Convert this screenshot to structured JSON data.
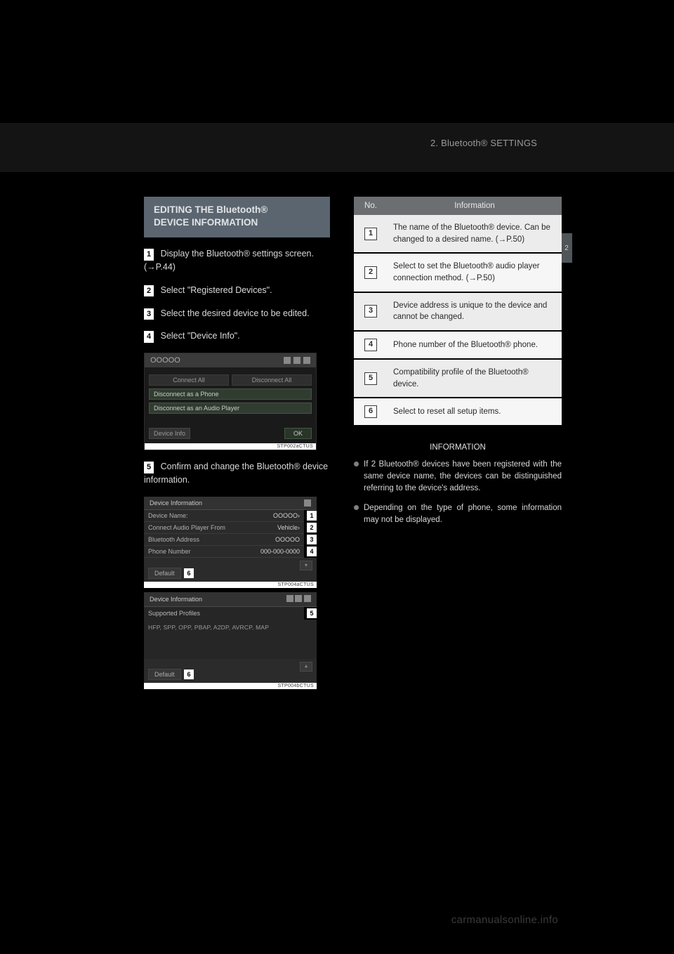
{
  "header": {
    "breadcrumb": "2. Bluetooth® SETTINGS"
  },
  "side_tab": "2",
  "section_title": {
    "line1": "EDITING THE Bluetooth®",
    "line2": "DEVICE INFORMATION"
  },
  "steps": {
    "s1": {
      "num": "1",
      "text": "Display the Bluetooth® settings screen. (→P.44)"
    },
    "s2": {
      "num": "2",
      "prefix": "Select ",
      "quote": "\"Registered Devices\"",
      "suffix": "."
    },
    "s3": {
      "num": "3",
      "text": "Select the desired device to be edited."
    },
    "s4": {
      "num": "4",
      "prefix": "Select ",
      "quote": "\"Device Info\"",
      "suffix": "."
    },
    "s5": {
      "num": "5",
      "text": "Confirm and change the Bluetooth® device information."
    }
  },
  "screenshot1": {
    "status": "OOOOO",
    "connect_all": "Connect All",
    "disconnect_all": "Disconnect All",
    "as_phone": "Disconnect as a Phone",
    "as_audio": "Disconnect as an Audio Player",
    "device_info": "Device Info",
    "ok": "OK",
    "ref": "STP002aCTUS"
  },
  "screenshot2": {
    "title": "Device Information",
    "rows": {
      "r1": {
        "label": "Device Name:",
        "value": "OOOOO›",
        "num": "1"
      },
      "r2": {
        "label": "Connect Audio Player From",
        "value": "Vehicle›",
        "num": "2"
      },
      "r3": {
        "label": "Bluetooth Address",
        "value": "OOOOO",
        "num": "3"
      },
      "r4": {
        "label": "Phone Number",
        "value": "000-000-0000",
        "num": "4"
      }
    },
    "default": "Default",
    "default_num": "6",
    "ref": "STP004aCTUS"
  },
  "screenshot3": {
    "title": "Device Information",
    "profiles_label": "Supported Profiles",
    "profiles_num": "5",
    "profiles_list": "HFP,  SPP,  OPP,  PBAP,  A2DP,  AVRCP,  MAP",
    "default": "Default",
    "default_num": "6",
    "ref": "STP004bCTUS"
  },
  "table": {
    "head_no": "No.",
    "head_info": "Information",
    "rows": [
      {
        "num": "1",
        "text": "The name of the Bluetooth® device. Can be changed to a desired name. (→P.50)"
      },
      {
        "num": "2",
        "text": "Select to set the Bluetooth® audio player connection method. (→P.50)"
      },
      {
        "num": "3",
        "text": "Device address is unique to the device and cannot be changed."
      },
      {
        "num": "4",
        "text": "Phone number of the Bluetooth® phone."
      },
      {
        "num": "5",
        "text": "Compatibility profile of the Bluetooth® device."
      },
      {
        "num": "6",
        "text": "Select to reset all setup items."
      }
    ]
  },
  "info_block": {
    "heading": "INFORMATION",
    "bullets": [
      "If 2 Bluetooth® devices have been registered with the same device name, the devices can be distinguished referring to the device's address.",
      "Depending on the type of phone, some information may not be displayed."
    ]
  },
  "watermark": "carmanualsonline.info"
}
